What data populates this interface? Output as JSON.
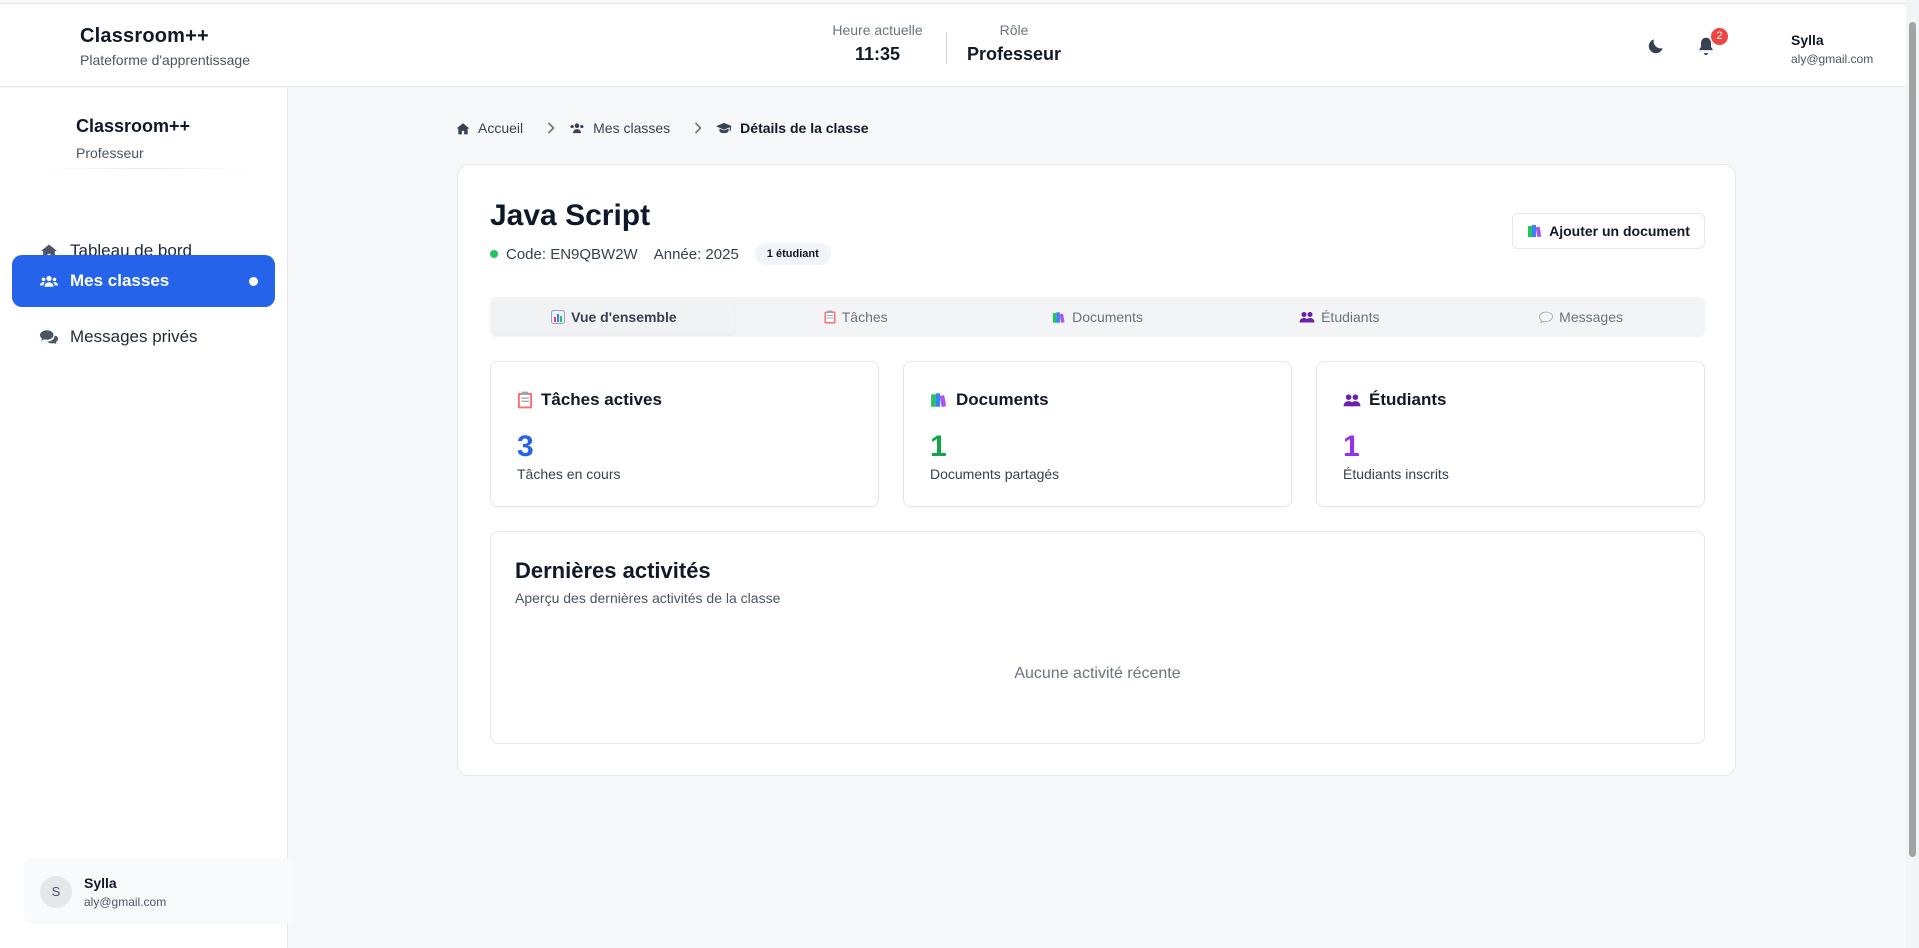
{
  "header": {
    "app_name": "Classroom++",
    "tagline": "Plateforme d'apprentissage",
    "time_label": "Heure actuelle",
    "time_value": "11:35",
    "role_label": "Rôle",
    "role_value": "Professeur",
    "notification_count": "2",
    "user_name": "Sylla",
    "user_email": "aly@gmail.com"
  },
  "sidebar": {
    "brand": "Classroom++",
    "role": "Professeur",
    "items": [
      {
        "label": "Tableau de bord",
        "icon": "home-icon"
      },
      {
        "label": "Mes classes",
        "icon": "users-icon",
        "active": true
      },
      {
        "label": "Messages privés",
        "icon": "comments-icon"
      }
    ],
    "user": {
      "initial": "S",
      "name": "Sylla",
      "email": "aly@gmail.com"
    }
  },
  "breadcrumb": {
    "home": "Accueil",
    "classes": "Mes classes",
    "current": "Détails de la classe"
  },
  "class": {
    "title": "Java Script",
    "code": "Code: EN9QBW2W",
    "year": "Année: 2025",
    "students_pill": "1 étudiant",
    "add_document": "Ajouter un document"
  },
  "tabs": [
    {
      "label": "Vue d'ensemble",
      "active": true
    },
    {
      "label": "Tâches"
    },
    {
      "label": "Documents"
    },
    {
      "label": "Étudiants"
    },
    {
      "label": "Messages"
    }
  ],
  "stats": [
    {
      "title": "Tâches actives",
      "value": "3",
      "caption": "Tâches en cours",
      "color": "#2563eb"
    },
    {
      "title": "Documents",
      "value": "1",
      "caption": "Documents partagés",
      "color": "#16a34a"
    },
    {
      "title": "Étudiants",
      "value": "1",
      "caption": "Étudiants inscrits",
      "color": "#9333ea"
    }
  ],
  "activity": {
    "title": "Dernières activités",
    "subtitle": "Aperçu des dernières activités de la classe",
    "empty": "Aucune activité récente"
  },
  "colors": {
    "primary": "#2563eb",
    "badge": "#ef4444",
    "online": "#22c55e"
  }
}
